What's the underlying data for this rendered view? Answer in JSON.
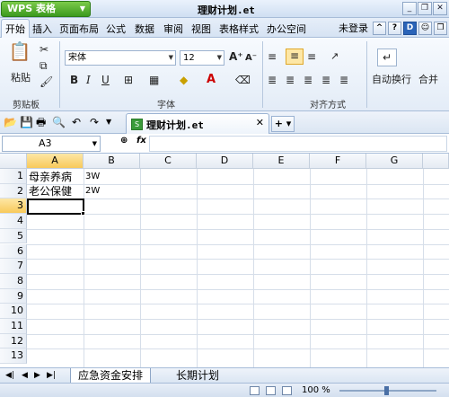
{
  "app": {
    "name": "WPS 表格",
    "doc_title": "理财计划.et"
  },
  "menu": {
    "tabs": [
      "开始",
      "插入",
      "页面布局",
      "公式",
      "数据",
      "审阅",
      "视图",
      "表格样式",
      "办公空间"
    ],
    "login": "未登录"
  },
  "ribbon": {
    "paste_label": "粘贴",
    "clipboard_label": "剪贴板",
    "font_name": "宋体",
    "font_size": "12",
    "bold": "B",
    "italic": "I",
    "underline": "U",
    "font_group_label": "字体",
    "align_group_label": "对齐方式",
    "wrap_label": "自动换行",
    "merge_label": "合并"
  },
  "doc_tab": {
    "name": "理财计划.et",
    "icon": "et-sheet-icon"
  },
  "formula_bar": {
    "cell_ref": "A3",
    "formula": ""
  },
  "grid": {
    "columns": [
      "A",
      "B",
      "C",
      "D",
      "E",
      "F",
      "G"
    ],
    "rows": [
      "1",
      "2",
      "3",
      "4",
      "5",
      "6",
      "7",
      "8",
      "9",
      "10",
      "11",
      "12",
      "13"
    ],
    "cells": {
      "A1": "母亲养病",
      "B1": "3W",
      "A2": "老公保健",
      "B2": "2W"
    },
    "selected": "A3"
  },
  "sheets": {
    "tabs": [
      "应急资金安排",
      "长期计划"
    ],
    "active": "应急资金安排"
  },
  "status": {
    "zoom": "100 %"
  },
  "colors": {
    "accent": "#3c9a1f",
    "selection_header": "#f8c95a"
  }
}
